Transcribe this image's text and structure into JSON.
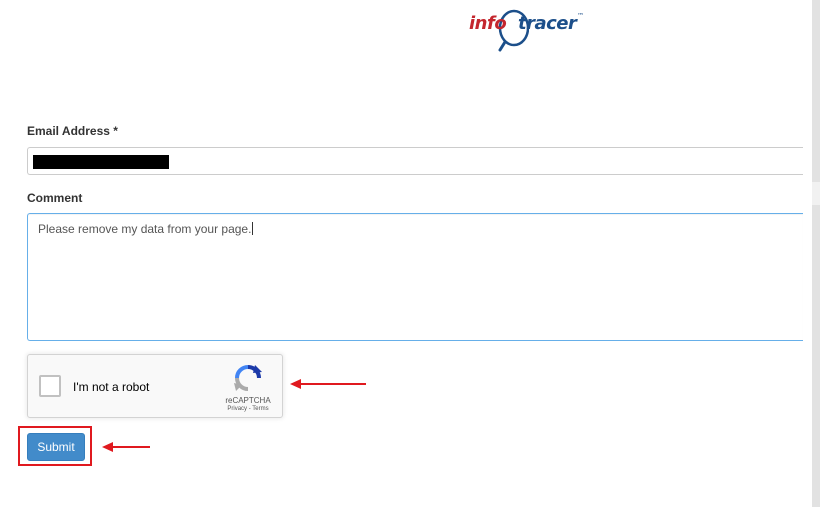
{
  "logo": {
    "part1": "info",
    "part2": "tracer",
    "trademark": "™"
  },
  "form": {
    "email_label": "Email Address *",
    "email_value": "",
    "comment_label": "Comment",
    "comment_value": "Please remove my data from your page.",
    "submit_label": "Submit"
  },
  "recaptcha": {
    "label": "I'm not a robot",
    "brand": "reCAPTCHA",
    "links": "Privacy - Terms",
    "checked": false
  },
  "colors": {
    "submit_bg": "#428bca",
    "annotation_red": "#e0191f",
    "logo_red": "#c4262e",
    "logo_blue": "#1c4f8a",
    "focus_border": "#66afe9"
  }
}
